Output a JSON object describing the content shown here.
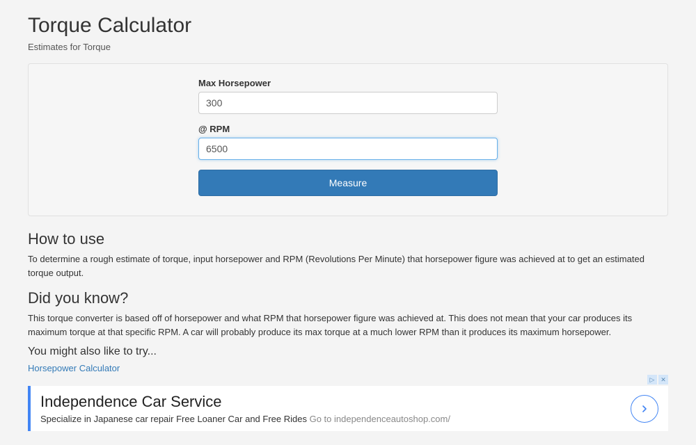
{
  "header": {
    "title": "Torque Calculator",
    "subtitle": "Estimates for Torque"
  },
  "form": {
    "hp_label": "Max Horsepower",
    "hp_value": "300",
    "rpm_label": "@ RPM",
    "rpm_value": "6500",
    "submit_label": "Measure"
  },
  "sections": {
    "how_to_use_heading": "How to use",
    "how_to_use_body": "To determine a rough estimate of torque, input horsepower and RPM (Revolutions Per Minute) that horsepower figure was achieved at to get an estimated torque output.",
    "did_you_know_heading": "Did you know?",
    "did_you_know_body": "This torque converter is based off of horsepower and what RPM that horsepower figure was achieved at. This does not mean that your car produces its maximum torque at that specific RPM. A car will probably produce its max torque at a much lower RPM than it produces its maximum horsepower.",
    "also_like_heading": "You might also like to try...",
    "also_like_link": "Horsepower Calculator"
  },
  "ad": {
    "title": "Independence Car Service",
    "subtitle": "Specialize in Japanese car repair Free Loaner Car and Free Rides ",
    "url": "Go to independenceautoshop.com/",
    "info_icon": "▷",
    "close_icon": "✕"
  }
}
